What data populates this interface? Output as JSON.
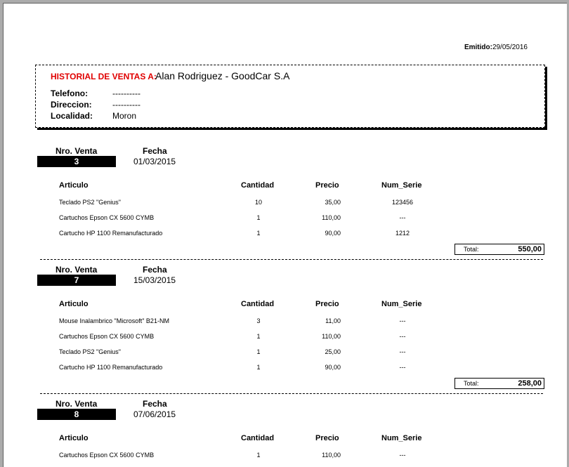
{
  "header": {
    "emitido_label": "Emitido:",
    "emitido_date": "29/05/2016"
  },
  "client": {
    "title": "HISTORIAL DE VENTAS A:",
    "name": "Alan Rodriguez - GoodCar S.A",
    "fields": [
      {
        "label": "Telefono:",
        "value": "----------"
      },
      {
        "label": "Direccion:",
        "value": "----------"
      },
      {
        "label": "Localidad:",
        "value": "Moron"
      }
    ]
  },
  "labels": {
    "nro_venta": "Nro. Venta",
    "fecha": "Fecha",
    "articulo": "Articulo",
    "cantidad": "Cantidad",
    "precio": "Precio",
    "num_serie": "Num_Serie",
    "total": "Total:"
  },
  "sales": [
    {
      "nro": "3",
      "fecha": "01/03/2015",
      "items": [
        {
          "articulo": "Teclado PS2 \"Genius\"",
          "cantidad": "10",
          "precio": "35,00",
          "serie": "123456"
        },
        {
          "articulo": "Cartuchos Epson CX 5600 CYMB",
          "cantidad": "1",
          "precio": "110,00",
          "serie": "---"
        },
        {
          "articulo": "Cartucho HP 1100 Remanufacturado",
          "cantidad": "1",
          "precio": "90,00",
          "serie": "1212"
        }
      ],
      "total": "550,00"
    },
    {
      "nro": "7",
      "fecha": "15/03/2015",
      "items": [
        {
          "articulo": "Mouse Inalambrico \"Microsoft\" B21-NM",
          "cantidad": "3",
          "precio": "11,00",
          "serie": "---"
        },
        {
          "articulo": "Cartuchos Epson CX 5600 CYMB",
          "cantidad": "1",
          "precio": "110,00",
          "serie": "---"
        },
        {
          "articulo": "Teclado PS2 \"Genius\"",
          "cantidad": "1",
          "precio": "25,00",
          "serie": "---"
        },
        {
          "articulo": "Cartucho HP 1100 Remanufacturado",
          "cantidad": "1",
          "precio": "90,00",
          "serie": "---"
        }
      ],
      "total": "258,00"
    },
    {
      "nro": "8",
      "fecha": "07/06/2015",
      "items": [
        {
          "articulo": "Cartuchos Epson CX 5600 CYMB",
          "cantidad": "1",
          "precio": "110,00",
          "serie": "---"
        }
      ]
    }
  ]
}
